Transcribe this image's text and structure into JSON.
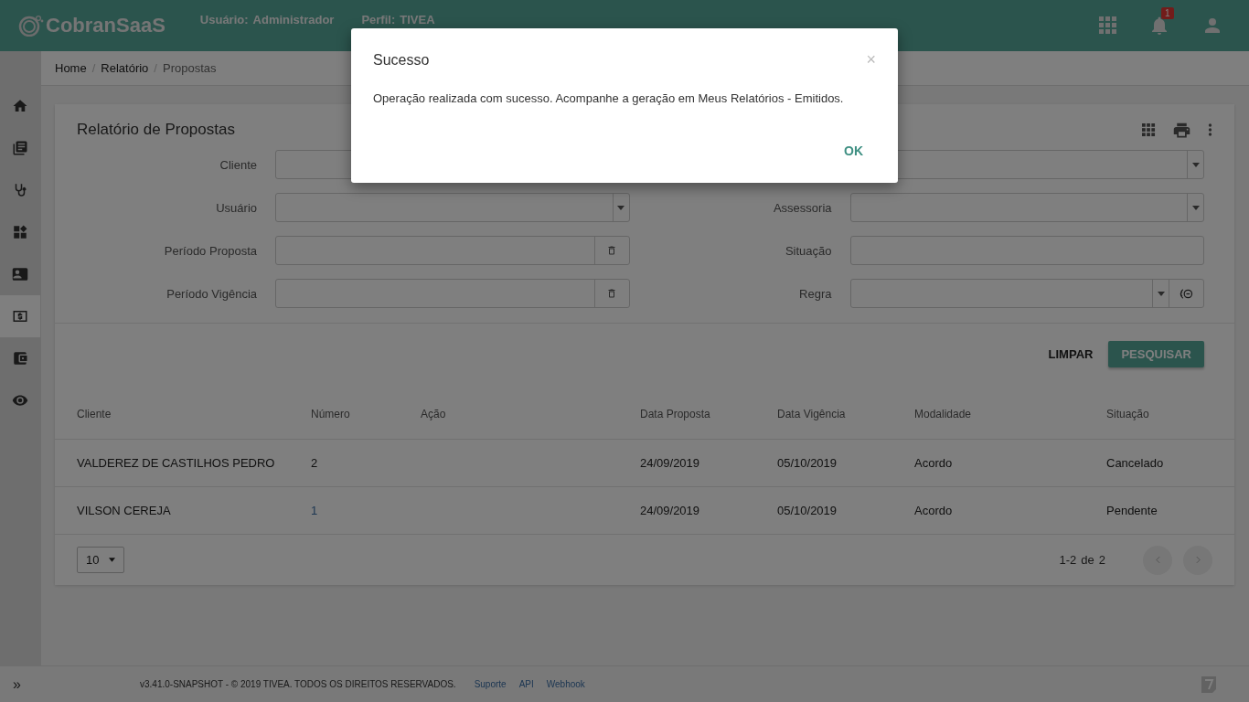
{
  "header": {
    "logo": "CobranSaaS",
    "user_label": "Usuário:",
    "user_value": "Administrador",
    "profile_label": "Perfil:",
    "profile_value": "TIVEA",
    "notification_count": "1"
  },
  "sidebar": {
    "items": [
      {
        "selected": false
      },
      {
        "selected": false
      },
      {
        "selected": false
      },
      {
        "selected": false
      },
      {
        "selected": false
      },
      {
        "selected": true
      },
      {
        "selected": false
      },
      {
        "selected": false
      }
    ],
    "expand": "»"
  },
  "breadcrumb": [
    {
      "label": "Home",
      "current": false
    },
    {
      "separator": "/",
      "label": "Relatório",
      "current": false
    },
    {
      "separator": "/",
      "label": "Propostas",
      "current": true
    }
  ],
  "card": {
    "title": "Relatório de Propostas",
    "fields": [
      {
        "label": "Cliente",
        "kind": "select"
      },
      {
        "kind": "select"
      },
      {
        "label": "Usuário",
        "kind": "select"
      },
      {
        "label": "Assessoria",
        "kind": "select"
      },
      {
        "label": "Período Proposta",
        "kind": "date"
      },
      {
        "label": "Situação",
        "kind": "text"
      },
      {
        "label": "Período Vigência",
        "kind": "date"
      },
      {
        "label": "Regra",
        "kind": "select_button"
      }
    ],
    "clear_button": "LIMPAR",
    "search_button": "PESQUISAR",
    "table": {
      "columns": [
        "Cliente",
        "Número",
        "Ação",
        "Data Proposta",
        "Data Vigência",
        "Modalidade",
        "Situação"
      ],
      "rows": [
        {
          "cells": [
            "VALDEREZ DE CASTILHOS PEDRO",
            "2",
            "",
            "24/09/2019",
            "05/10/2019",
            "Acordo",
            "Cancelado"
          ],
          "number_link": false
        },
        {
          "cells": [
            "VILSON CEREJA",
            "1",
            "",
            "24/09/2019",
            "05/10/2019",
            "Acordo",
            "Pendente"
          ],
          "number_link": true
        }
      ]
    },
    "page_size": "10",
    "range": "1-2",
    "range_of": "de",
    "total": "2"
  },
  "footer": {
    "copyright": "v3.41.0-SNAPSHOT - © 2019 TIVEA. TODOS OS DIREITOS RESERVADOS.",
    "links": [
      "Suporte",
      "API",
      "Webhook"
    ]
  },
  "dialog": {
    "title": "Sucesso",
    "close": "×",
    "message": "Operação realizada com sucesso. Acompanhe a geração em Meus Relatórios - Emitidos.",
    "ok": "OK"
  }
}
